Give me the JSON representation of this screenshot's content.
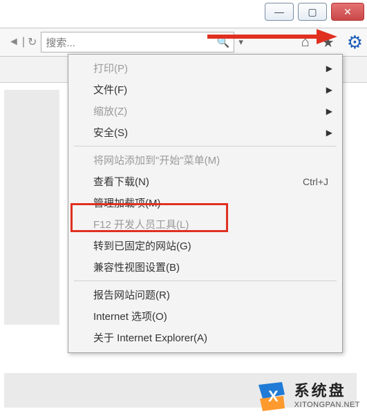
{
  "window_controls": {
    "min": "—",
    "max": "▢",
    "close": "✕"
  },
  "toolbar": {
    "back_glyph": "◄",
    "sep": "|",
    "fav_glyph": "",
    "search_placeholder": "搜索...",
    "search_icon": "🔍",
    "dropdown_glyph": "▾",
    "home_glyph": "⌂",
    "star_glyph": "★",
    "gear_glyph": "⚙"
  },
  "menu": {
    "items": [
      {
        "label": "打印(P)",
        "disabled": true,
        "submenu": true
      },
      {
        "label": "文件(F)",
        "submenu": true
      },
      {
        "label": "缩放(Z)",
        "disabled": true,
        "submenu": true
      },
      {
        "label": "安全(S)",
        "submenu": true
      },
      {
        "sep": true
      },
      {
        "label": "将网站添加到\"开始\"菜单(M)",
        "disabled": true
      },
      {
        "label": "查看下载(N)",
        "shortcut": "Ctrl+J"
      },
      {
        "label": "管理加载项(M)",
        "highlight": true
      },
      {
        "label": "F12 开发人员工具(L)",
        "disabled": true
      },
      {
        "label": "转到已固定的网站(G)"
      },
      {
        "label": "兼容性视图设置(B)"
      },
      {
        "sep": true
      },
      {
        "label": "报告网站问题(R)"
      },
      {
        "label": "Internet 选项(O)"
      },
      {
        "label": "关于 Internet Explorer(A)"
      }
    ],
    "sub_arrow": "▶"
  },
  "watermark": {
    "cn": "系统盘",
    "en": "XITONGPAN.NET"
  }
}
